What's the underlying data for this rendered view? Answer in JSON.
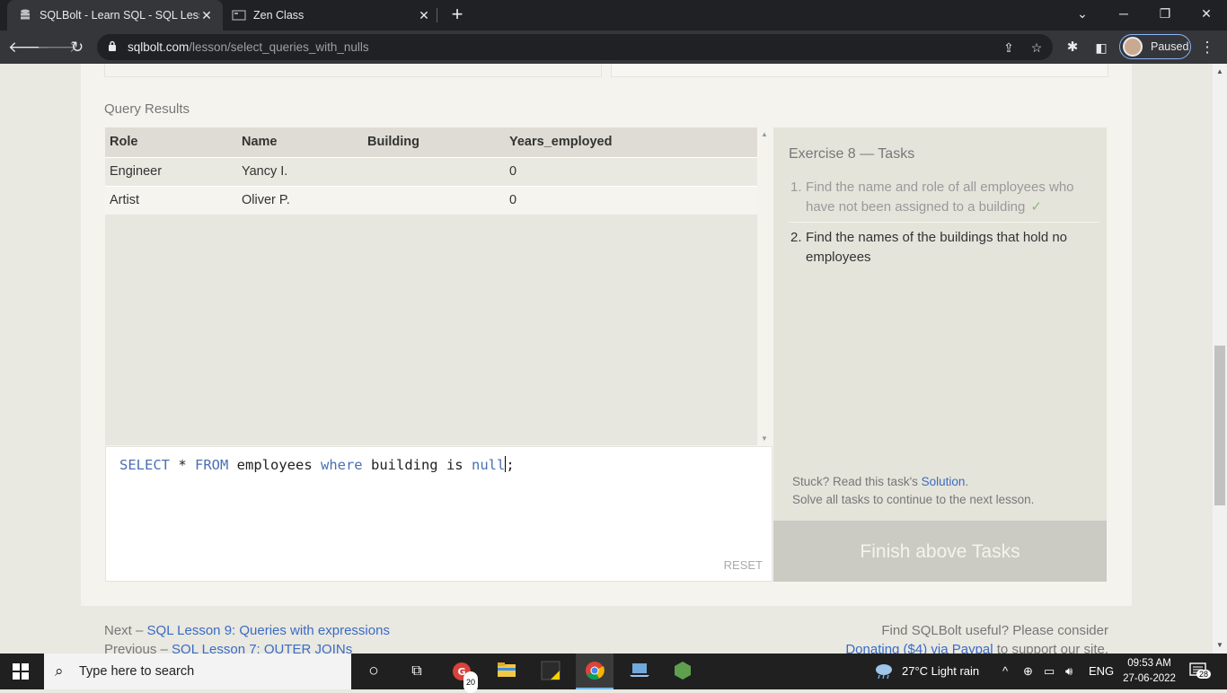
{
  "browser": {
    "tabs": [
      {
        "title": "SQLBolt - Learn SQL - SQL Lesson",
        "active": true
      },
      {
        "title": "Zen Class",
        "active": false
      }
    ],
    "url_host": "sqlbolt.com",
    "url_path": "/lesson/select_queries_with_nulls",
    "profile_label": "Paused"
  },
  "results": {
    "label": "Query Results",
    "columns": [
      "Role",
      "Name",
      "Building",
      "Years_employed"
    ],
    "rows": [
      [
        "Engineer",
        "Yancy I.",
        "",
        "0"
      ],
      [
        "Artist",
        "Oliver P.",
        "",
        "0"
      ]
    ]
  },
  "editor": {
    "query_parts": [
      "SELECT",
      " * ",
      "FROM",
      " employees ",
      "where",
      " building is ",
      "null",
      ";"
    ],
    "reset_label": "RESET"
  },
  "tasks": {
    "title": "Exercise 8 — Tasks",
    "items": [
      {
        "num": "1.",
        "text": "Find the name and role of all employees who have not been assigned to a building",
        "done": true,
        "check": "✓"
      },
      {
        "num": "2.",
        "text": "Find the names of the buildings that hold no employees",
        "done": false
      }
    ],
    "stuck_prefix": "Stuck? Read this task's ",
    "stuck_link": "Solution",
    "stuck_suffix": ".",
    "continue_text": "Solve all tasks to continue to the next lesson.",
    "finish_label": "Finish above Tasks"
  },
  "footer": {
    "next_prefix": "Next – ",
    "next_link": "SQL Lesson 9: Queries with expressions",
    "prev_prefix": "Previous – ",
    "prev_link": "SQL Lesson 7: OUTER JOINs",
    "right_line1": "Find SQLBolt useful? Please consider",
    "donate_link": "Donating ($4) via Paypal",
    "right_suffix": " to support our site."
  },
  "taskbar": {
    "search_placeholder": "Type here to search",
    "mail_badge": "20",
    "weather": "27°C  Light rain",
    "lang": "ENG",
    "time": "09:53 AM",
    "date": "27-06-2022",
    "notif_badge": "28"
  }
}
